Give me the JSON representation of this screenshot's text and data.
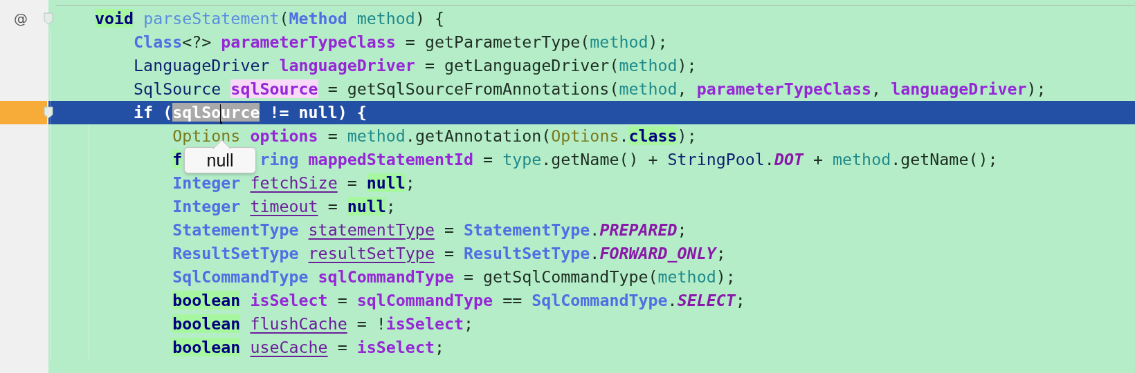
{
  "editor": {
    "lines": [
      {
        "selected": false,
        "fold": true,
        "gutter_mark": "@",
        "tokens": [
          {
            "kind": "keyword",
            "text": "void",
            "highlighted": true
          },
          {
            "kind": "method",
            "text": " parseStatement"
          },
          {
            "kind": "plain",
            "text": "("
          },
          {
            "kind": "type",
            "text": "Method"
          },
          {
            "kind": "param",
            "text": " method"
          },
          {
            "kind": "plain",
            "text": ") {"
          }
        ],
        "children": [
          {
            "selected": false,
            "fold": false,
            "tokens": [
              {
                "kind": "type",
                "text": "Class"
              },
              {
                "kind": "plain",
                "text": "<?> "
              },
              {
                "kind": "decl",
                "text": "parameterTypeClass"
              },
              {
                "kind": "plain",
                "text": " = getParameterType("
              },
              {
                "kind": "param",
                "text": "method"
              },
              {
                "kind": "plain",
                "text": ");"
              }
            ]
          },
          {
            "selected": false,
            "fold": false,
            "tokens": [
              {
                "kind": "class",
                "text": "LanguageDriver "
              },
              {
                "kind": "decl",
                "text": "languageDriver"
              },
              {
                "kind": "plain",
                "text": " = getLanguageDriver("
              },
              {
                "kind": "param",
                "text": "method"
              },
              {
                "kind": "plain",
                "text": ");"
              }
            ]
          },
          {
            "selected": false,
            "fold": false,
            "tokens": [
              {
                "kind": "class",
                "text": "SqlSource "
              },
              {
                "kind": "decl",
                "text": "sqlSource",
                "write_usage": true
              },
              {
                "kind": "plain",
                "text": " = getSqlSourceFromAnnotations("
              },
              {
                "kind": "param",
                "text": "method"
              },
              {
                "kind": "plain",
                "text": ", "
              },
              {
                "kind": "decl",
                "text": "parameterTypeClass"
              },
              {
                "kind": "plain",
                "text": ", "
              },
              {
                "kind": "decl",
                "text": "languageDriver"
              },
              {
                "kind": "plain",
                "text": ");"
              }
            ]
          },
          {
            "selected": true,
            "fold": true,
            "tokens": [
              {
                "kind": "keyword",
                "text": "if"
              },
              {
                "kind": "plain",
                "text": " ("
              },
              {
                "kind": "decl",
                "text": "sqlSo",
                "in_selection": true
              },
              {
                "kind": "decl",
                "text": "urce",
                "in_selection": true,
                "caret": true
              },
              {
                "kind": "plain",
                "text": " != "
              },
              {
                "kind": "keyword",
                "text": "null"
              },
              {
                "kind": "plain",
                "text": ") {"
              }
            ],
            "children": [
              {
                "selected": false,
                "fold": false,
                "tokens": [
                  {
                    "kind": "annotation",
                    "text": "Options "
                  },
                  {
                    "kind": "decl",
                    "text": "options"
                  },
                  {
                    "kind": "plain",
                    "text": " = "
                  },
                  {
                    "kind": "param",
                    "text": "method"
                  },
                  {
                    "kind": "plain",
                    "text": ".getAnnotation("
                  },
                  {
                    "kind": "annotation",
                    "text": "Options"
                  },
                  {
                    "kind": "plain",
                    "text": "."
                  },
                  {
                    "kind": "keyword",
                    "text": "class",
                    "highlighted": true
                  },
                  {
                    "kind": "plain",
                    "text": ");"
                  }
                ]
              },
              {
                "selected": false,
                "fold": false,
                "tokens": [
                  {
                    "kind": "keyword",
                    "text": "f",
                    "highlighted": true
                  },
                  {
                    "kind": "type",
                    "text": "ring ",
                    "after_tooltip": true
                  },
                  {
                    "kind": "decl",
                    "text": "mappedStatementId"
                  },
                  {
                    "kind": "plain",
                    "text": " = "
                  },
                  {
                    "kind": "param",
                    "text": "type"
                  },
                  {
                    "kind": "plain",
                    "text": ".getName() + "
                  },
                  {
                    "kind": "class",
                    "text": "StringPool"
                  },
                  {
                    "kind": "plain",
                    "text": "."
                  },
                  {
                    "kind": "const",
                    "text": "DOT"
                  },
                  {
                    "kind": "plain",
                    "text": " + "
                  },
                  {
                    "kind": "param",
                    "text": "method"
                  },
                  {
                    "kind": "plain",
                    "text": ".getName();"
                  }
                ]
              },
              {
                "selected": false,
                "fold": false,
                "tokens": [
                  {
                    "kind": "type",
                    "text": "Integer "
                  },
                  {
                    "kind": "local",
                    "text": "fetchSize"
                  },
                  {
                    "kind": "plain",
                    "text": " = "
                  },
                  {
                    "kind": "keyword",
                    "text": "null",
                    "highlighted": true
                  },
                  {
                    "kind": "plain",
                    "text": ";"
                  }
                ]
              },
              {
                "selected": false,
                "fold": false,
                "tokens": [
                  {
                    "kind": "type",
                    "text": "Integer "
                  },
                  {
                    "kind": "local",
                    "text": "timeout"
                  },
                  {
                    "kind": "plain",
                    "text": " = "
                  },
                  {
                    "kind": "keyword",
                    "text": "null",
                    "highlighted": true
                  },
                  {
                    "kind": "plain",
                    "text": ";"
                  }
                ]
              },
              {
                "selected": false,
                "fold": false,
                "tokens": [
                  {
                    "kind": "type",
                    "text": "StatementType "
                  },
                  {
                    "kind": "local",
                    "text": "statementType"
                  },
                  {
                    "kind": "plain",
                    "text": " = "
                  },
                  {
                    "kind": "type",
                    "text": "StatementType"
                  },
                  {
                    "kind": "plain",
                    "text": "."
                  },
                  {
                    "kind": "const",
                    "text": "PREPARED"
                  },
                  {
                    "kind": "plain",
                    "text": ";"
                  }
                ]
              },
              {
                "selected": false,
                "fold": false,
                "tokens": [
                  {
                    "kind": "type",
                    "text": "ResultSetType "
                  },
                  {
                    "kind": "local",
                    "text": "resultSetType"
                  },
                  {
                    "kind": "plain",
                    "text": " = "
                  },
                  {
                    "kind": "type",
                    "text": "ResultSetType"
                  },
                  {
                    "kind": "plain",
                    "text": "."
                  },
                  {
                    "kind": "const",
                    "text": "FORWARD_ONLY"
                  },
                  {
                    "kind": "plain",
                    "text": ";"
                  }
                ]
              },
              {
                "selected": false,
                "fold": false,
                "tokens": [
                  {
                    "kind": "type",
                    "text": "SqlCommandType "
                  },
                  {
                    "kind": "decl",
                    "text": "sqlCommandType"
                  },
                  {
                    "kind": "plain",
                    "text": " = getSqlCommandType("
                  },
                  {
                    "kind": "param",
                    "text": "method"
                  },
                  {
                    "kind": "plain",
                    "text": ");"
                  }
                ]
              },
              {
                "selected": false,
                "fold": false,
                "tokens": [
                  {
                    "kind": "keyword",
                    "text": "boolean",
                    "highlighted": true
                  },
                  {
                    "kind": "decl",
                    "text": " isSelect"
                  },
                  {
                    "kind": "plain",
                    "text": " = "
                  },
                  {
                    "kind": "decl",
                    "text": "sqlCommandType"
                  },
                  {
                    "kind": "plain",
                    "text": " == "
                  },
                  {
                    "kind": "type",
                    "text": "SqlCommandType"
                  },
                  {
                    "kind": "plain",
                    "text": "."
                  },
                  {
                    "kind": "const",
                    "text": "SELECT"
                  },
                  {
                    "kind": "plain",
                    "text": ";"
                  }
                ]
              },
              {
                "selected": false,
                "fold": false,
                "tokens": [
                  {
                    "kind": "keyword",
                    "text": "boolean",
                    "highlighted": true
                  },
                  {
                    "kind": "local",
                    "text": " flushCache"
                  },
                  {
                    "kind": "plain",
                    "text": " = !"
                  },
                  {
                    "kind": "decl",
                    "text": "isSelect"
                  },
                  {
                    "kind": "plain",
                    "text": ";"
                  }
                ]
              },
              {
                "selected": false,
                "fold": false,
                "tokens": [
                  {
                    "kind": "keyword",
                    "text": "boolean",
                    "highlighted": true
                  },
                  {
                    "kind": "local",
                    "text": " useCache"
                  },
                  {
                    "kind": "plain",
                    "text": " = "
                  },
                  {
                    "kind": "decl",
                    "text": "isSelect"
                  },
                  {
                    "kind": "plain",
                    "text": ";"
                  }
                ]
              }
            ]
          }
        ]
      }
    ],
    "tooltip": {
      "text": "null"
    }
  }
}
